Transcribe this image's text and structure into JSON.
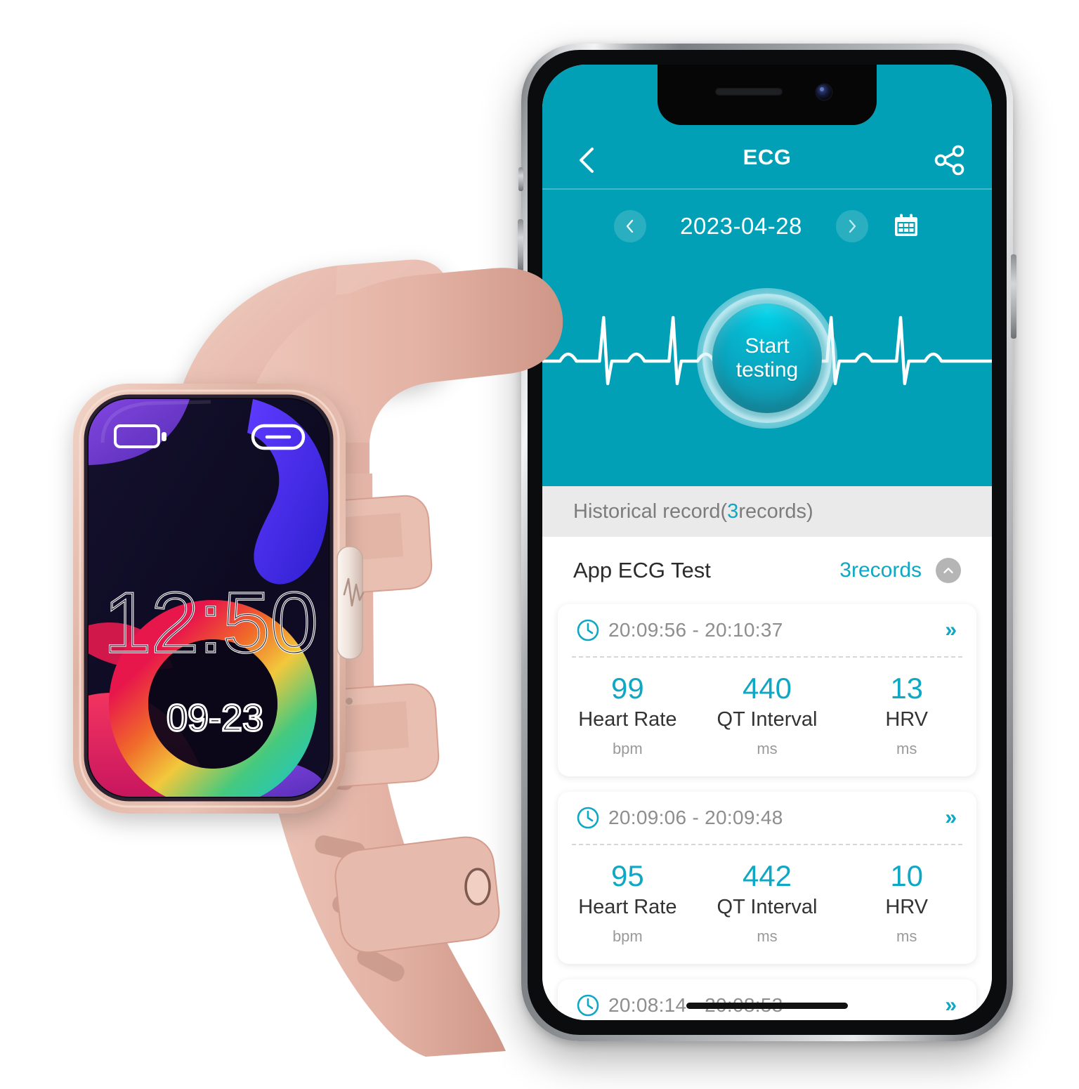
{
  "app": {
    "nav": {
      "title": "ECG",
      "back_icon": "chevron-left-icon",
      "share_icon": "share-icon"
    },
    "date_picker": {
      "date": "2023-04-28",
      "prev_icon": "chevron-left-icon",
      "next_icon": "chevron-right-icon",
      "calendar_icon": "calendar-icon"
    },
    "start_button": {
      "line1": "Start",
      "line2": "testing"
    },
    "history": {
      "bar_prefix": "Historical record(",
      "bar_count": "3",
      "bar_suffix": "records)",
      "group_title": "App ECG Test",
      "group_count": "3records",
      "records": [
        {
          "time": "20:09:56 - 20:10:37",
          "metrics": [
            {
              "value": "99",
              "name": "Heart Rate",
              "unit": "bpm"
            },
            {
              "value": "440",
              "name": "QT Interval",
              "unit": "ms"
            },
            {
              "value": "13",
              "name": "HRV",
              "unit": "ms"
            }
          ]
        },
        {
          "time": "20:09:06 - 20:09:48",
          "metrics": [
            {
              "value": "95",
              "name": "Heart Rate",
              "unit": "bpm"
            },
            {
              "value": "442",
              "name": "QT Interval",
              "unit": "ms"
            },
            {
              "value": "10",
              "name": "HRV",
              "unit": "ms"
            }
          ]
        },
        {
          "time": "20:08:14 - 20:08:53",
          "metrics": []
        }
      ]
    }
  },
  "watch": {
    "time": "12:50",
    "date": "09-23",
    "battery_icon": "battery-icon",
    "link_icon": "link-icon",
    "side_button_icon": "heartbeat-icon"
  },
  "colors": {
    "teal_bg": "#02A0B6",
    "accent_cyan": "#0FA8C4",
    "history_bar_bg": "#eaeaea",
    "card_bg": "#ffffff",
    "band_pink": "#E8B5A9"
  }
}
